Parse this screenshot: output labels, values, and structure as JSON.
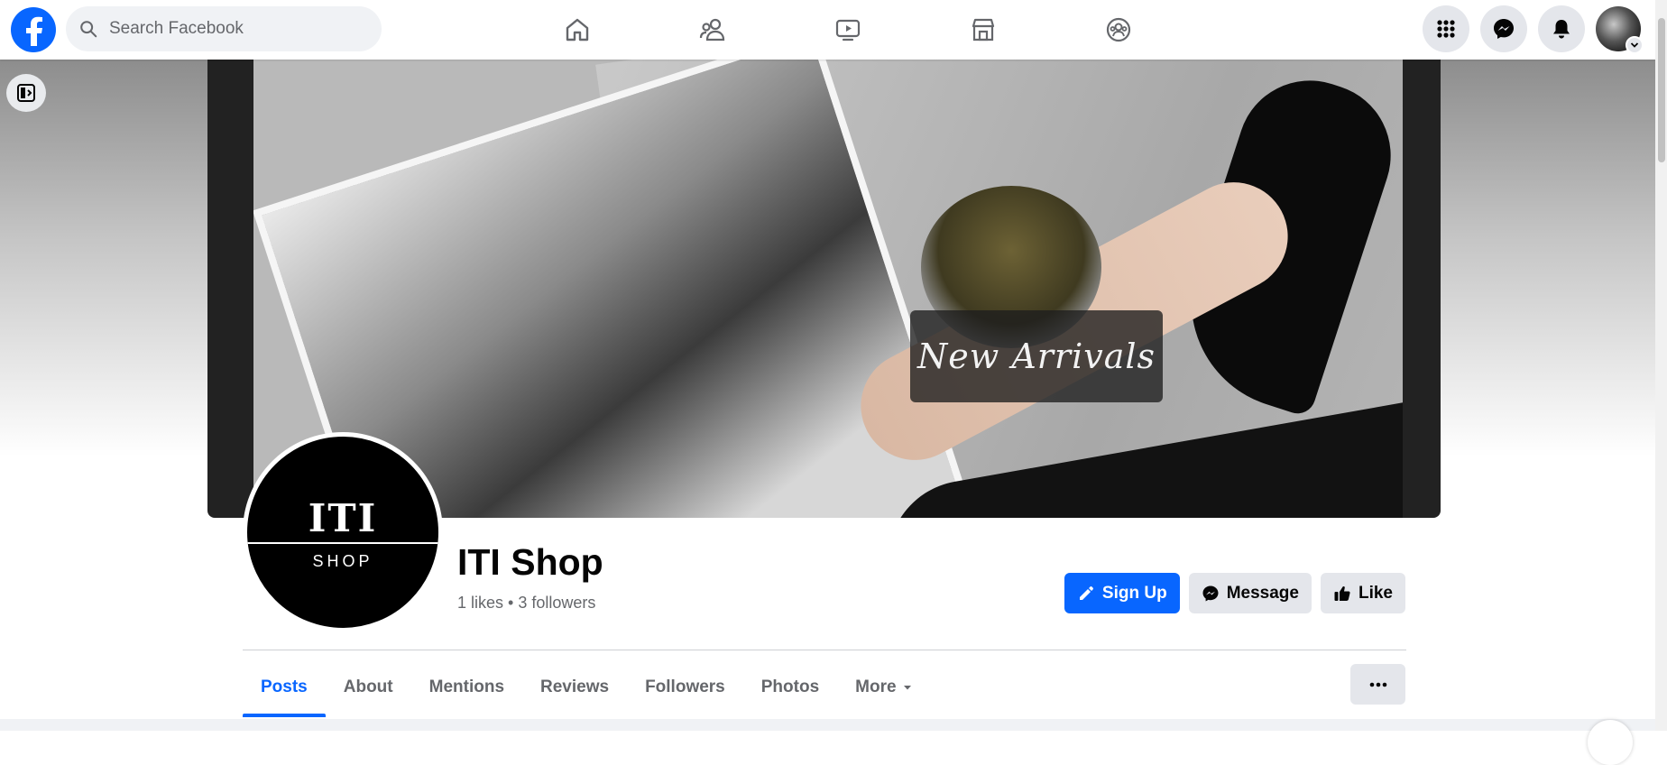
{
  "header": {
    "search_placeholder": "Search Facebook",
    "nav_icons": [
      "home-icon",
      "friends-icon",
      "watch-icon",
      "marketplace-icon",
      "groups-icon"
    ],
    "right_icons": [
      "menu-grid-icon",
      "messenger-icon",
      "notifications-icon",
      "account-avatar"
    ]
  },
  "cover": {
    "overlay_text": "New Arrivals"
  },
  "profile": {
    "logo_main": "ITI",
    "logo_sub": "SHOP",
    "name": "ITI Shop",
    "stats": "1 likes • 3 followers"
  },
  "actions": {
    "sign_up": "Sign Up",
    "message": "Message",
    "like": "Like"
  },
  "tabs": [
    {
      "label": "Posts",
      "active": true
    },
    {
      "label": "About"
    },
    {
      "label": "Mentions"
    },
    {
      "label": "Reviews"
    },
    {
      "label": "Followers"
    },
    {
      "label": "Photos"
    },
    {
      "label": "More"
    }
  ],
  "colors": {
    "brand": "#0866ff",
    "secondary_button": "#e4e6eb",
    "muted_text": "#65676b"
  }
}
